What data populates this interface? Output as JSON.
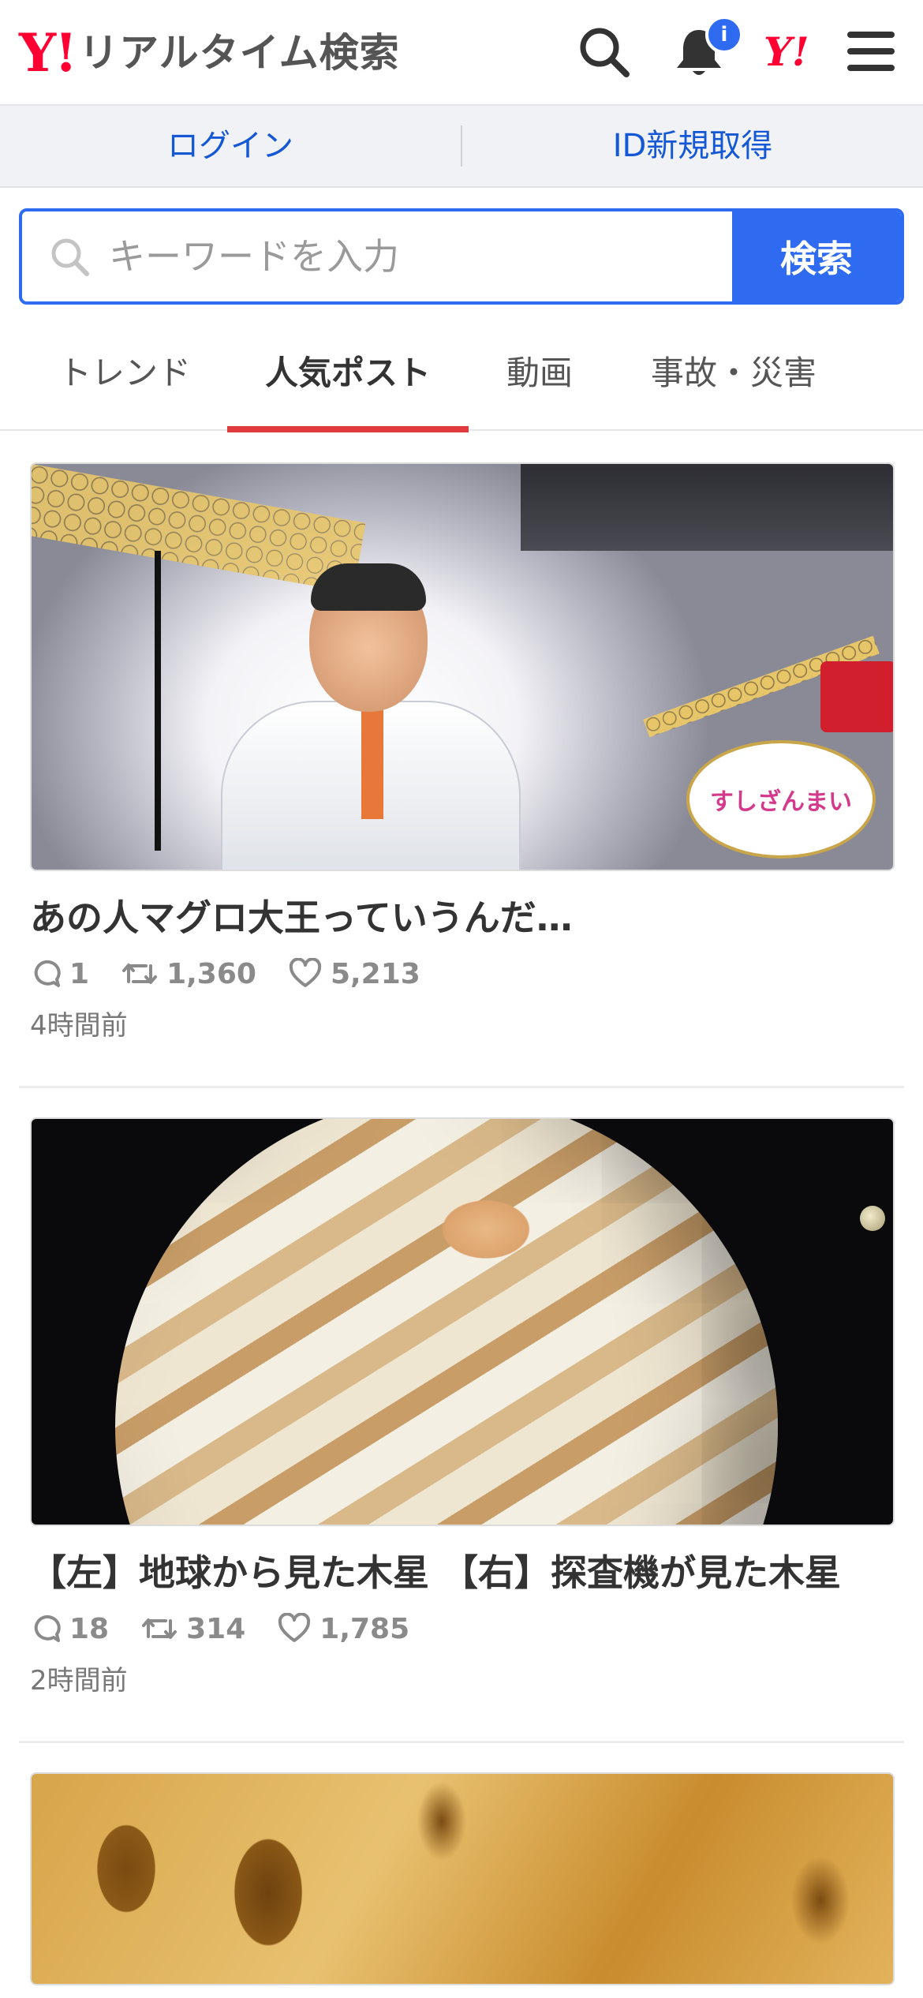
{
  "header": {
    "logo_mark": "Y!",
    "logo_text": "リアルタイム検索",
    "notification_badge": "i",
    "yahoo_mark": "Y!"
  },
  "login_bar": {
    "login": "ログイン",
    "signup": "ID新規取得"
  },
  "search": {
    "placeholder": "キーワードを入力",
    "button": "検索"
  },
  "tabs": [
    {
      "label": "トレンド",
      "active": false
    },
    {
      "label": "人気ポスト",
      "active": true
    },
    {
      "label": "動画",
      "active": false
    },
    {
      "label": "事故・災害",
      "active": false
    }
  ],
  "posts": [
    {
      "title": "あの人マグロ大王っていうんだ…",
      "replies": "1",
      "reposts": "1,360",
      "likes": "5,213",
      "time": "4時間前",
      "image_text": "すしざんまい"
    },
    {
      "title": "【左】地球から見た木星 【右】探査機が見た木星",
      "replies": "18",
      "reposts": "314",
      "likes": "1,785",
      "time": "2時間前"
    }
  ],
  "colors": {
    "accent_blue": "#2e6bf0",
    "link_blue": "#1558d6",
    "yahoo_red": "#ff0033",
    "active_tab_underline": "#e0393e"
  }
}
